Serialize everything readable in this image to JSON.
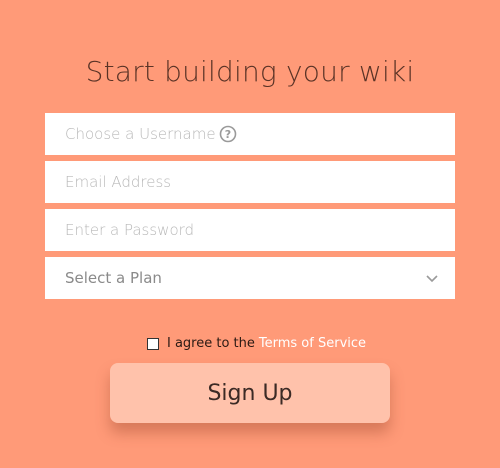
{
  "page": {
    "title": "Start building your wiki"
  },
  "form": {
    "username_placeholder": "Choose a Username",
    "email_placeholder": "Email Address",
    "password_placeholder": "Enter a Password",
    "plan_selected": "Select a Plan",
    "agree_text": "I agree to the",
    "tos_link": "Terms of Service",
    "submit_label": "Sign Up"
  },
  "icons": {
    "help": "question-circle-icon",
    "dropdown": "chevron-down-icon"
  },
  "colors": {
    "background": "#FF9A78",
    "button": "#FFC2AB",
    "title": "#5A3326",
    "link": "#FFFFFF"
  }
}
